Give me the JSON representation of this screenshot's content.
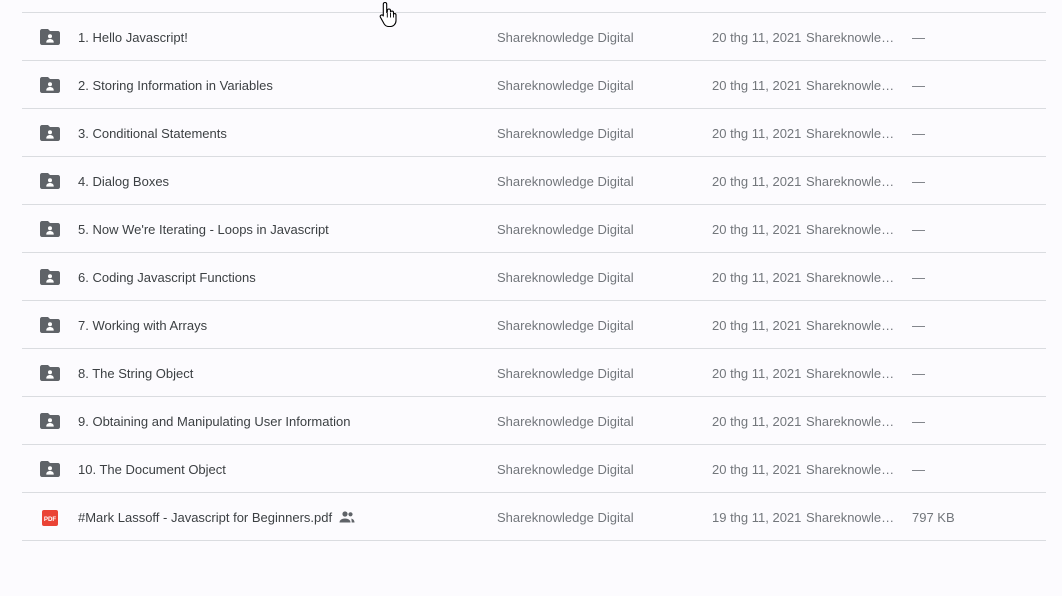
{
  "files": [
    {
      "name": "1. Hello Javascript!",
      "type": "shared-folder",
      "owner": "Shareknowledge Digital",
      "modified": "20 thg 11, 2021",
      "modified_by": "Shareknowledge Digital",
      "size": "—"
    },
    {
      "name": "2. Storing Information in Variables",
      "type": "shared-folder",
      "owner": "Shareknowledge Digital",
      "modified": "20 thg 11, 2021",
      "modified_by": "Shareknowledge Digital",
      "size": "—"
    },
    {
      "name": "3. Conditional Statements",
      "type": "shared-folder",
      "owner": "Shareknowledge Digital",
      "modified": "20 thg 11, 2021",
      "modified_by": "Shareknowledge Digital",
      "size": "—"
    },
    {
      "name": "4. Dialog Boxes",
      "type": "shared-folder",
      "owner": "Shareknowledge Digital",
      "modified": "20 thg 11, 2021",
      "modified_by": "Shareknowledge Digital",
      "size": "—"
    },
    {
      "name": "5. Now We're Iterating - Loops in Javascript",
      "type": "shared-folder",
      "owner": "Shareknowledge Digital",
      "modified": "20 thg 11, 2021",
      "modified_by": "Shareknowledge Digital",
      "size": "—"
    },
    {
      "name": "6. Coding Javascript Functions",
      "type": "shared-folder",
      "owner": "Shareknowledge Digital",
      "modified": "20 thg 11, 2021",
      "modified_by": "Shareknowledge Digital",
      "size": "—"
    },
    {
      "name": "7. Working with Arrays",
      "type": "shared-folder",
      "owner": "Shareknowledge Digital",
      "modified": "20 thg 11, 2021",
      "modified_by": "Shareknowledge Digital",
      "size": "—"
    },
    {
      "name": "8. The String Object",
      "type": "shared-folder",
      "owner": "Shareknowledge Digital",
      "modified": "20 thg 11, 2021",
      "modified_by": "Shareknowledge Digital",
      "size": "—"
    },
    {
      "name": "9. Obtaining and Manipulating User Information",
      "type": "shared-folder",
      "owner": "Shareknowledge Digital",
      "modified": "20 thg 11, 2021",
      "modified_by": "Shareknowledge Digital",
      "size": "—"
    },
    {
      "name": "10. The Document Object",
      "type": "shared-folder",
      "owner": "Shareknowledge Digital",
      "modified": "20 thg 11, 2021",
      "modified_by": "Shareknowledge Digital",
      "size": "—"
    },
    {
      "name": "#Mark Lassoff - Javascript for Beginners.pdf",
      "type": "pdf",
      "shared": true,
      "owner": "Shareknowledge Digital",
      "modified": "19 thg 11, 2021",
      "modified_by": "Shareknowledge Digital",
      "size": "797 KB"
    }
  ],
  "icons": {
    "folder": "shared-folder-icon",
    "pdf": "pdf-file-icon",
    "pdf_label": "PDF",
    "shared": "people-icon",
    "cursor": "hand-pointer-cursor"
  },
  "colors": {
    "folder_icon": "#5f6368",
    "pdf_icon": "#ea4335",
    "name_text": "#3c4043",
    "meta_text": "#72767b",
    "divider": "#dadce0"
  }
}
